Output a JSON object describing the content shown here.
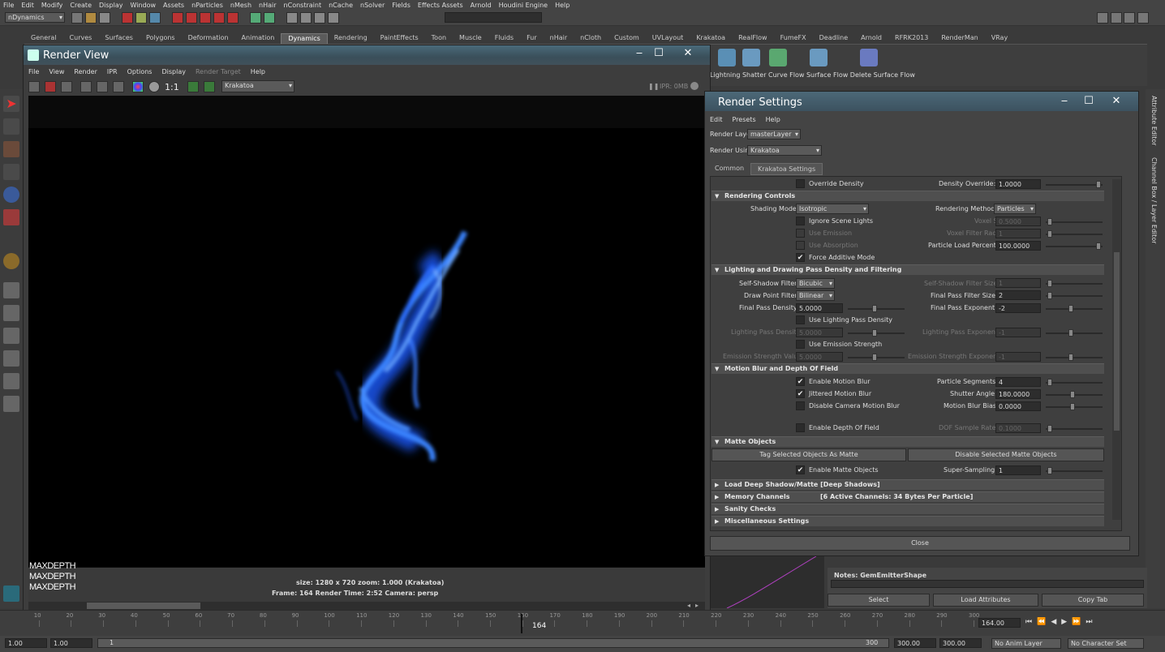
{
  "main_menu": [
    "File",
    "Edit",
    "Modify",
    "Create",
    "Display",
    "Window",
    "Assets",
    "nParticles",
    "nMesh",
    "nHair",
    "nConstraint",
    "nCache",
    "nSolver",
    "Fields",
    "Effects Assets",
    "Arnold",
    "Houdini Engine",
    "Help"
  ],
  "menuset": "nDynamics",
  "shelf_tabs": [
    "General",
    "Curves",
    "Surfaces",
    "Polygons",
    "Deformation",
    "Animation",
    "Dynamics",
    "Rendering",
    "PaintEffects",
    "Toon",
    "Muscle",
    "Fluids",
    "Fur",
    "nHair",
    "nCloth",
    "Custom",
    "UVLayout",
    "Krakatoa",
    "RealFlow",
    "FumeFX",
    "Deadline",
    "Arnold",
    "RFRK2013",
    "RenderMan",
    "VRay"
  ],
  "shelf_active_tab": "Dynamics",
  "shelf_labels": "Lightning Shatter Curve Flow Surface Flow Delete Surface Flow",
  "render_view": {
    "title": "Render View",
    "menu": [
      "File",
      "View",
      "Render",
      "IPR",
      "Options",
      "Display"
    ],
    "menu_disabled": "Render Target",
    "menu_help": "Help",
    "renderer": "Krakatoa",
    "ratio_label": "1:1",
    "ipr_label": "IPR: 0MB",
    "info_line1": "size: 1280 x 720  zoom: 1.000        (Krakatoa)",
    "info_line2": "Frame: 164      Render Time: 2:52      Camera: persp",
    "logo_lines": [
      "MAXDEPTH",
      "MAXDEPTH",
      "MAXDEPTH"
    ]
  },
  "render_settings": {
    "title": "Render Settings",
    "menu": [
      "Edit",
      "Presets",
      "Help"
    ],
    "render_layer_label": "Render Layer",
    "render_layer": "masterLayer",
    "render_using_label": "Render Using",
    "render_using": "Krakatoa",
    "tabs": [
      "Common",
      "Krakatoa Settings"
    ],
    "override_density": "Override Density",
    "density_override_label": "Density Override:",
    "density_override": "1.0000",
    "sections": {
      "rendering_controls": "Rendering Controls",
      "lighting": "Lighting and Drawing Pass Density and Filtering",
      "motion_blur": "Motion Blur and Depth Of Field",
      "matte": "Matte Objects",
      "deep_shadow": "Load Deep Shadow/Matte   [Deep Shadows]",
      "memory": "Memory Channels",
      "memory_info": "[6 Active Channels: 34 Bytes Per Particle]",
      "sanity": "Sanity Checks",
      "misc": "Miscellaneous Settings"
    },
    "rc": {
      "shading_mode_label": "Shading Mode:",
      "shading_mode": "Isotropic",
      "rendering_method_label": "Rendering Method:",
      "rendering_method": "Particles",
      "ignore_scene_lights": "Ignore Scene Lights",
      "voxel_size_label": "Voxel Size:",
      "voxel_size": "0.5000",
      "use_emission": "Use Emission",
      "voxel_filter_label": "Voxel Filter Radius:",
      "voxel_filter": "1",
      "use_absorption": "Use Absorption",
      "particle_load_label": "Particle Load Percent:",
      "particle_load": "100.0000",
      "force_additive": "Force Additive Mode"
    },
    "lp": {
      "self_shadow_label": "Self-Shadow Filter:",
      "self_shadow": "Bicubic",
      "self_shadow_size_label": "Self-Shadow Filter Size:",
      "self_shadow_size": "1",
      "draw_point_label": "Draw Point Filter:",
      "draw_point": "Bilinear",
      "final_filter_size_label": "Final Pass Filter Size:",
      "final_filter_size": "2",
      "final_density_label": "Final Pass Density:",
      "final_density": "5.0000",
      "final_exponent_label": "Final Pass Exponent:",
      "final_exponent": "-2",
      "use_lighting_density": "Use Lighting Pass Density",
      "lighting_density_label": "Lighting Pass Density:",
      "lighting_density": "5.0000",
      "lighting_exponent_label": "Lighting Pass Exponent:",
      "lighting_exponent": "-1",
      "use_emission_strength": "Use Emission Strength",
      "emission_value_label": "Emission Strength Value:",
      "emission_value": "5.0000",
      "emission_exponent_label": "Emission Strength Exponent:",
      "emission_exponent": "-1"
    },
    "mb": {
      "enable_motion_blur": "Enable Motion Blur",
      "particle_segments_label": "Particle Segments:",
      "particle_segments": "4",
      "jittered": "Jittered Motion Blur",
      "shutter_angle_label": "Shutter Angle:",
      "shutter_angle": "180.0000",
      "disable_camera": "Disable Camera Motion Blur",
      "mb_bias_label": "Motion Blur Bias:",
      "mb_bias": "0.0000",
      "enable_dof": "Enable Depth Of Field",
      "dof_rate_label": "DOF Sample Rate:",
      "dof_rate": "0.1000"
    },
    "mo": {
      "tag_btn": "Tag Selected Objects As Matte",
      "disable_btn": "Disable Selected Matte Objects",
      "enable_matte": "Enable Matte Objects",
      "super_label": "Super-Sampling:",
      "super": "1"
    },
    "close": "Close"
  },
  "right_panel": {
    "attribute_editor": "Attribute Editor",
    "channel_box": "Channel Box / Layer Editor",
    "notes": "Notes:  GemEmitterShape",
    "select": "Select",
    "load_attributes": "Load Attributes",
    "copy_tab": "Copy Tab"
  },
  "timeline": {
    "ticks": [
      "10",
      "20",
      "30",
      "40",
      "50",
      "60",
      "70",
      "80",
      "90",
      "100",
      "110",
      "120",
      "130",
      "140",
      "150",
      "160",
      "170",
      "180",
      "190",
      "200",
      "210",
      "220",
      "230",
      "240",
      "250",
      "260",
      "270",
      "280",
      "290",
      "300"
    ],
    "current_frame": "164",
    "current_frame_field": "164.00"
  },
  "range": {
    "start1": "1.00",
    "start2": "1.00",
    "slider_start": "1",
    "slider_end": "300",
    "end1": "300.00",
    "end2": "300.00",
    "anim_layer": "No Anim Layer",
    "char_set": "No Character Set"
  }
}
